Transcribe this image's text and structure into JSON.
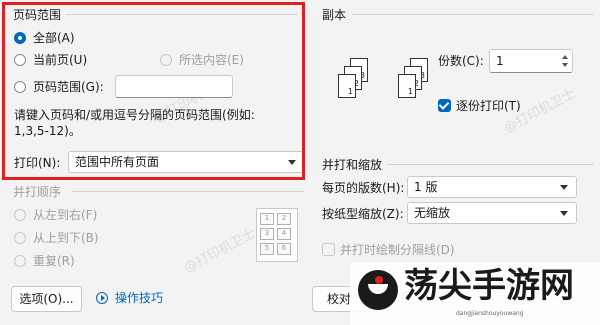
{
  "page_range": {
    "title": "页码范围",
    "all": "全部(A)",
    "current": "当前页(U)",
    "selection": "所选内容(E)",
    "pages": "页码范围(G):",
    "pages_value": "",
    "hint_line1": "请键入页码和/或用逗号分隔的页码范围(例如:",
    "hint_line2": "1,3,5-12)。",
    "print_label": "打印(N):",
    "print_value": "范围中所有页面"
  },
  "order": {
    "title": "并打顺序",
    "ltr": "从左到右(F)",
    "ttb": "从上到下(B)",
    "repeat": "重复(R)",
    "grid": [
      "1",
      "2",
      "3",
      "4",
      "5",
      "6"
    ]
  },
  "copies": {
    "title": "副本",
    "count_label": "份数(C):",
    "count_value": "1",
    "collate": "逐份打印(T)",
    "collate_checked": true,
    "stack_pages": [
      "3",
      "2",
      "1"
    ]
  },
  "zoom": {
    "title": "并打和缩放",
    "per_sheet_label": "每页的版数(H):",
    "per_sheet_value": "1 版",
    "scale_label": "按纸型缩放(Z):",
    "scale_value": "无缩放",
    "draw_lines": "并打时绘制分隔线(D)"
  },
  "footer": {
    "options": "选项(O)...",
    "tips": "操作技巧",
    "proof": "校对"
  },
  "watermarks": {
    "text": "@打印机卫士",
    "brand": "荡尖手游网",
    "brand_sub": "dangjianshouyouwang"
  },
  "colors": {
    "accent": "#0067c0",
    "highlight": "#e02020"
  }
}
